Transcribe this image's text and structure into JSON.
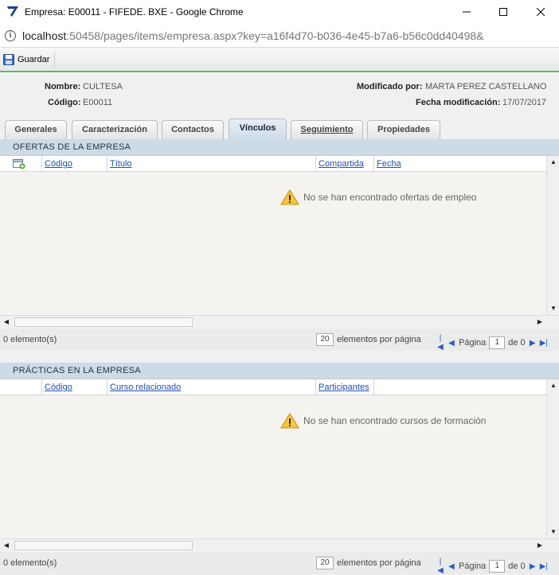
{
  "window": {
    "title": "Empresa: E00011 - FIFEDE. BXE - Google Chrome",
    "url_host": "localhost",
    "url_rest": ":50458/pages/items/empresa.aspx?key=a16f4d70-b036-4e45-b7a6-b56c0dd40498&"
  },
  "toolbar": {
    "save_label": "Guardar"
  },
  "header": {
    "nombre_label": "Nombre:",
    "nombre_value": "CULTESA",
    "codigo_label": "Código:",
    "codigo_value": "E00011",
    "modificado_label": "Modificado por:",
    "modificado_value": "MARTA PEREZ CASTELLANO",
    "fecha_label": "Fecha modificación:",
    "fecha_value": "17/07/2017"
  },
  "tabs": [
    {
      "label": "Generales"
    },
    {
      "label": "Caracterización"
    },
    {
      "label": "Contactos"
    },
    {
      "label": "Vínculos"
    },
    {
      "label": "Seguimiento"
    },
    {
      "label": "Propiedades"
    }
  ],
  "active_tab": "Vínculos",
  "ofertas": {
    "title": "OFERTAS DE LA EMPRESA",
    "columns": [
      "Código",
      "Título",
      "Compartida",
      "Fecha"
    ],
    "empty_message": "No se han encontrado ofertas de empleo",
    "count": "0 elemento(s)",
    "per_page": "20",
    "per_page_label": "elementos por página",
    "page_label": "Página",
    "page": "1",
    "of_label": "de 0"
  },
  "practicas": {
    "title": "PRÁCTICAS EN LA EMPRESA",
    "columns": [
      "Código",
      "Curso relacionado",
      "Participantes"
    ],
    "empty_message": "No se han encontrado cursos de formación",
    "count": "0 elemento(s)",
    "per_page": "20",
    "per_page_label": "elementos por página",
    "page_label": "Página",
    "page": "1",
    "of_label": "de 0"
  },
  "colors": {
    "accent_green": "#4ec24e",
    "section_bg": "#cddbe7",
    "link_blue": "#1f4fb4"
  }
}
